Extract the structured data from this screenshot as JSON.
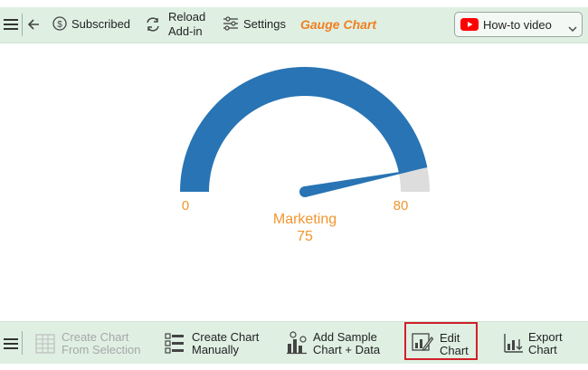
{
  "toolbar": {
    "subscribed_label": "Subscribed",
    "reload_label_line1": "Reload",
    "reload_label_line2": "Add-in",
    "settings_label": "Settings",
    "title": "Gauge Chart",
    "video_select_label": "How-to video"
  },
  "bottom_toolbar": {
    "create_from_selection_line1": "Create Chart",
    "create_from_selection_line2": "From Selection",
    "create_manually_line1": "Create Chart",
    "create_manually_line2": "Manually",
    "add_sample_line1": "Add Sample",
    "add_sample_line2": "Chart + Data",
    "edit_line1": "Edit",
    "edit_line2": "Chart",
    "export_line1": "Export",
    "export_line2": "Chart"
  },
  "chart_data": {
    "type": "gauge",
    "min": 0,
    "max": 80,
    "min_label": "0",
    "max_label": "80",
    "value": 75,
    "value_label": "75",
    "label": "Marketing",
    "colors": {
      "fill": "#2874b4",
      "remaining": "#dddddd",
      "needle": "#2874b4",
      "text": "#f0962e"
    }
  },
  "colors": {
    "toolbar_bg": "#dff0e3",
    "title": "#f07f21",
    "highlight_border": "#d0202a",
    "youtube_red": "#ff0000"
  }
}
